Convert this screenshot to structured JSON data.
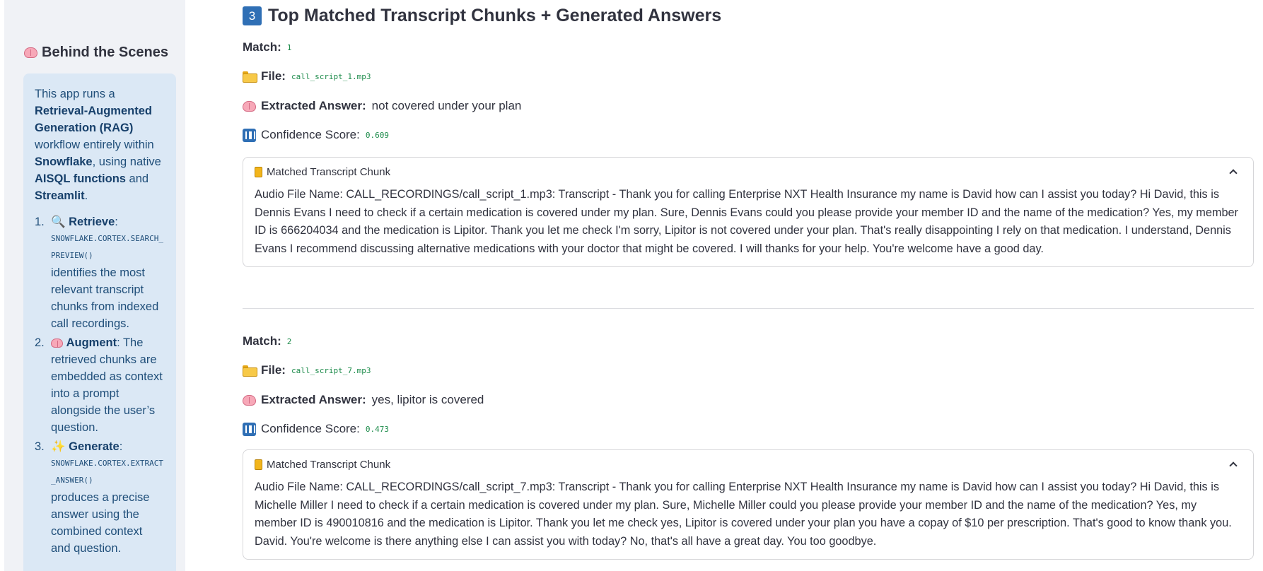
{
  "sidebar": {
    "title": "Behind the Scenes",
    "intro": {
      "t1": "This app runs a ",
      "b1": "Retrieval-Augmented Generation (RAG)",
      "t2": " workflow entirely within ",
      "b2": "Snowflake",
      "t3": ", using native ",
      "b3": "AISQL functions",
      "t4": " and ",
      "b4": "Streamlit",
      "t5": "."
    },
    "steps": [
      {
        "num": "1.",
        "name": "Retrieve",
        "code": "SNOWFLAKE.CORTEX.SEARCH_PREVIEW()",
        "text": "identifies the most relevant transcript chunks from indexed call recordings."
      },
      {
        "num": "2.",
        "name": "Augment",
        "text": "The retrieved chunks are embedded as context into a prompt alongside the user’s question."
      },
      {
        "num": "3.",
        "name": "Generate",
        "code": "SNOWFLAKE.CORTEX.EXTRACT_ANSWER()",
        "text": "produces a precise answer using the combined context and question."
      }
    ]
  },
  "main": {
    "title_badge": "3",
    "title": "Top Matched Transcript Chunks + Generated Answers",
    "labels": {
      "match": "Match:",
      "file": "File:",
      "answer": "Extracted Answer:",
      "confidence": "Confidence Score:",
      "chunk": "Matched Transcript Chunk"
    },
    "matches": [
      {
        "index": "1",
        "file": "call_script_1.mp3",
        "answer": "not covered under your plan",
        "confidence": "0.609",
        "chunk": "Audio File Name: CALL_RECORDINGS/call_script_1.mp3: Transcript - Thank you for calling Enterprise NXT Health Insurance my name is David how can I assist you today? Hi David, this is Dennis Evans I need to check if a certain medication is covered under my plan. Sure, Dennis Evans could you please provide your member ID and the name of the medication? Yes, my member ID is 666204034 and the medication is Lipitor. Thank you let me check I'm sorry, Lipitor is not covered under your plan. That's really disappointing I rely on that medication. I understand, Dennis Evans I recommend discussing alternative medications with your doctor that might be covered. I will thanks for your help. You're welcome have a good day."
      },
      {
        "index": "2",
        "file": "call_script_7.mp3",
        "answer": "yes, lipitor is covered",
        "confidence": "0.473",
        "chunk": "Audio File Name: CALL_RECORDINGS/call_script_7.mp3: Transcript - Thank you for calling Enterprise NXT Health Insurance my name is David how can I assist you today? Hi David, this is Michelle Miller I need to check if a certain medication is covered under my plan. Sure, Michelle Miller could you please provide your member ID and the name of the medication? Yes, my member ID is 490010816 and the medication is Lipitor. Thank you let me check yes, Lipitor is covered under your plan you have a copay of $10 per prescription. That's good to know thank you. David. You're welcome is there anything else I can assist you with today? No, that's all have a great day. You too goodbye."
      }
    ]
  }
}
